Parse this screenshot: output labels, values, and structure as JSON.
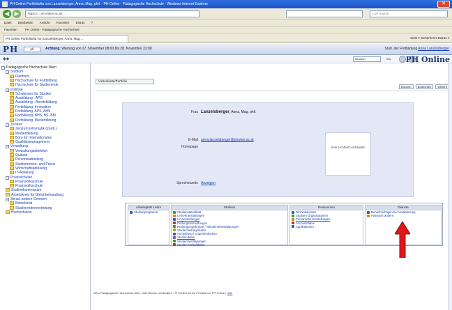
{
  "browser": {
    "title": "PH Online Portfolio/ita von Lanzelsberger, Anna, Mag. phil. - PH Online - Pädagogische Hochschule - Windows Internet Explorer",
    "address": "https://... ph-online.ac.at/...",
    "address_right": "",
    "search_placeholder": "Live Search",
    "menu": [
      "Datei",
      "Bearbeiten",
      "Ansicht",
      "Favoriten",
      "Extras",
      "?"
    ],
    "favorites": [
      "Favoriten",
      "PH Online - Pädagogische Hochschule"
    ],
    "tab_label": "PH Online Portfolio/ita von Lanzelsberger, Anna, Mag....",
    "cmd": "Seite ▾  Sicherheit ▾  Extras ▾"
  },
  "header": {
    "logo": "PH",
    "ph_button": "ph",
    "attention_label": "Achtung:",
    "attention_text": "Wartung von 27. November 08:00 bis 28. November 23:00",
    "user_prefix": "Stud. der Fortbildung",
    "user_name": "Anna Lanzelsberger",
    "select": "Deutsch",
    "go": "Go",
    "brand": "PH Online"
  },
  "sidebar": {
    "items": [
      {
        "label": "Pädagogische Hochschule Wien",
        "type": "root",
        "level": 0
      },
      {
        "label": "Studium",
        "type": "branch",
        "level": 1
      },
      {
        "label": "Plattform",
        "type": "leaf",
        "level": 2
      },
      {
        "label": "Hochschule für Fortbildung",
        "type": "leaf",
        "level": 2
      },
      {
        "label": "Hochschule für Studierende",
        "type": "leaf",
        "level": 2
      },
      {
        "label": "Institute",
        "type": "branch",
        "level": 1
      },
      {
        "label": "Schulpraxis für Studien",
        "type": "leaf",
        "level": 2
      },
      {
        "label": "Ausbildung - APS",
        "type": "leaf",
        "level": 2
      },
      {
        "label": "Ausbildung - Berufsbildung",
        "type": "leaf",
        "level": 2
      },
      {
        "label": "Fortbildung, Innovation",
        "type": "leaf",
        "level": 2
      },
      {
        "label": "Fortbildung, APS, AHS",
        "type": "leaf",
        "level": 2
      },
      {
        "label": "Fortbildung, BHS, BS, BM",
        "type": "leaf",
        "level": 2
      },
      {
        "label": "Fortbildung, Weiterbildung",
        "type": "leaf",
        "level": 2
      },
      {
        "label": "Zentren",
        "type": "branch",
        "level": 1
      },
      {
        "label": "Zentrum Informatik (Zentr.)",
        "type": "leaf",
        "level": 2
      },
      {
        "label": "Medienbildung",
        "type": "leaf",
        "level": 2
      },
      {
        "label": "Büro für Internationales",
        "type": "leaf",
        "level": 2
      },
      {
        "label": "Qualitätsmanagement",
        "type": "leaf",
        "level": 2
      },
      {
        "label": "Verwaltung",
        "type": "branch",
        "level": 1
      },
      {
        "label": "Verwaltungsdirektion",
        "type": "leaf",
        "level": 2
      },
      {
        "label": "Quästur",
        "type": "leaf",
        "level": 2
      },
      {
        "label": "Personalabteilung",
        "type": "leaf",
        "level": 2
      },
      {
        "label": "Studienreisen- und Praxis",
        "type": "leaf",
        "level": 2
      },
      {
        "label": "Wirtschaftsabteilung",
        "type": "leaf",
        "level": 2
      },
      {
        "label": "IT-Abteilung",
        "type": "leaf",
        "level": 2
      },
      {
        "label": "Praxisschulen",
        "type": "branch",
        "level": 1
      },
      {
        "label": "Praxisvolksschule",
        "type": "leaf",
        "level": 2
      },
      {
        "label": "Praxisvolksschule",
        "type": "leaf",
        "level": 2
      },
      {
        "label": "Studienkommission",
        "type": "leaf",
        "level": 1
      },
      {
        "label": "Arbeitskreis für Gleichbehandlung",
        "type": "leaf",
        "level": 1
      },
      {
        "label": "Senat, andere Gremien",
        "type": "branch",
        "level": 1
      },
      {
        "label": "Betriebsrat",
        "type": "leaf",
        "level": 2
      },
      {
        "label": "Studierendenvertretung",
        "type": "leaf",
        "level": 2
      },
      {
        "label": "Hochschulrat",
        "type": "leaf",
        "level": 1
      }
    ]
  },
  "main": {
    "tab": "Visitenkarte/Portfolio",
    "actions": [
      "Drucken",
      "Bearbeiten",
      "Weitere"
    ],
    "card": {
      "name_prefix": "Frau",
      "name_bold": "Lanzelsberger",
      "name_suffix": ", Anna, Mag. phil.",
      "email_label": "E-Mail",
      "email_value": "anna.lanzelsberger@phwien.ac.at",
      "homepage_label": "Homepage",
      "homepage_value": "",
      "photo_text": "Kein Lichtbild vorhanden",
      "sprechstunde_label": "Sprechstunde",
      "sprechstunde_value": "Anzeigen"
    },
    "columns": [
      {
        "header": "Arbeitsplatz Lehre",
        "links": [
          {
            "label": "Studienprogramm",
            "color": "#2f5fb3"
          }
        ]
      },
      {
        "header": "Studium",
        "links": [
          {
            "label": "Studienstatusblatt",
            "color": "#3d9a2e"
          },
          {
            "label": "Lehrveranstaltungen",
            "color": "#c98a1e"
          },
          {
            "label": "LV-Anmeldungen",
            "color": "#2f5fb3"
          },
          {
            "label": "Prüfungsanmeldungen",
            "color": "#b33a2f"
          },
          {
            "label": "Prüfungsergebnisse / Teilnahmebestätigungen",
            "color": "#3d9a2e"
          },
          {
            "label": "Studienbeitragsstatus",
            "color": "#c98a1e"
          },
          {
            "label": "Anmeldung / Ungereimtheiten",
            "color": "#2f5fb3"
          },
          {
            "label": "Studiendaten",
            "color": "#7a5fb3"
          },
          {
            "label": "Studienbestätigungen",
            "color": "#3d9a2e"
          },
          {
            "label": "Studien-Fixhaftdaten",
            "color": "#b33a2f"
          }
        ]
      },
      {
        "header": "Ressourcen",
        "links": [
          {
            "label": "Terminkalender",
            "color": "#2f5fb3"
          },
          {
            "label": "Studium Organisationen",
            "color": "#3d9a2e"
          },
          {
            "label": "Persönliche Einstellungen",
            "color": "#c98a1e"
          },
          {
            "label": "Accountstatus",
            "color": "#b33a2f"
          },
          {
            "label": "Applikationen",
            "color": "#2f5fb3"
          }
        ]
      },
      {
        "header": "Dienste",
        "links": [
          {
            "label": "Benachrichtigen bei Veränderung",
            "color": "#2f5fb3"
          },
          {
            "label": "Passwort ändern",
            "color": "#c98a1e"
          }
        ]
      }
    ],
    "footer_text": "Mein Pädagogische Hochschule Wien | Alle Rechte vorbehalten - PH Online ist ein Produkt von PH Online |",
    "footer_link": "Hilfe"
  },
  "colors": {
    "card_bg": "#e4e7f6",
    "link": "#1a3fb0",
    "arrow": "#e0171a"
  }
}
